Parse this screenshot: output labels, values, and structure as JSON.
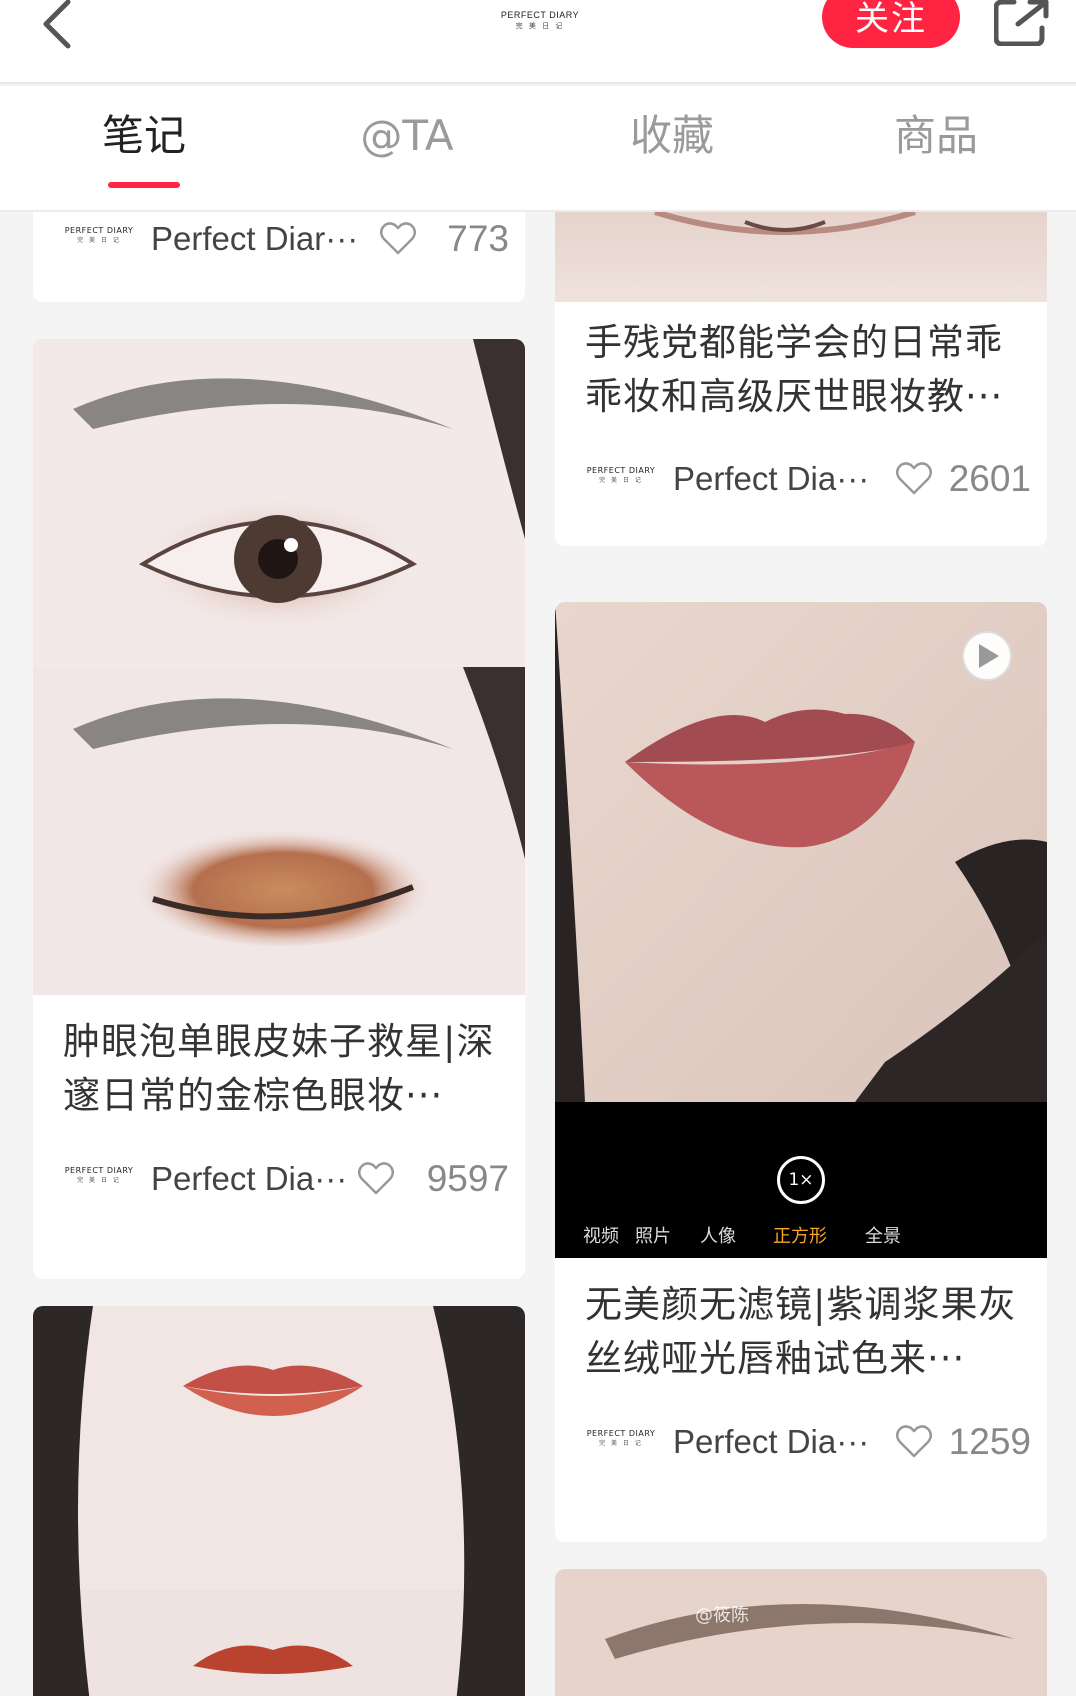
{
  "header": {
    "brand_line1": "PERFECT DIARY",
    "brand_line2": "完 美 日 记",
    "follow_label": "关注"
  },
  "tabs": [
    {
      "label": "笔记",
      "active": true
    },
    {
      "label": "@TA",
      "active": false
    },
    {
      "label": "收藏",
      "active": false
    },
    {
      "label": "商品",
      "active": false
    }
  ],
  "brand_logo": {
    "line1": "PERFECT DIARY",
    "line2": "完 美 日 记"
  },
  "posts": [
    {
      "title": "",
      "author": "Perfect Diar···",
      "likes": "773"
    },
    {
      "title": "手残党都能学会的日常乖乖妆和高级厌世眼妆教···",
      "author": "Perfect Dia···",
      "likes": "2601"
    },
    {
      "title": "肿眼泡单眼皮妹子救星|深邃日常的金棕色眼妆···",
      "author": "Perfect Dia···",
      "likes": "9597"
    },
    {
      "title": "无美颜无滤镜|紫调浆果灰丝绒哑光唇釉试色来···",
      "author": "Perfect Dia···",
      "likes": "1259"
    }
  ],
  "camera_ui": {
    "zoom": "1×",
    "modes": [
      "视频",
      "照片",
      "人像",
      "正方形",
      "全景"
    ],
    "selected": "正方形"
  },
  "watermark": "@筱陈",
  "colors": {
    "accent": "#ff2442",
    "page_bg": "#f4f4f5",
    "camera_selected": "#f5a623"
  },
  "icons": [
    "back-icon",
    "share-icon",
    "heart-icon",
    "play-icon"
  ]
}
